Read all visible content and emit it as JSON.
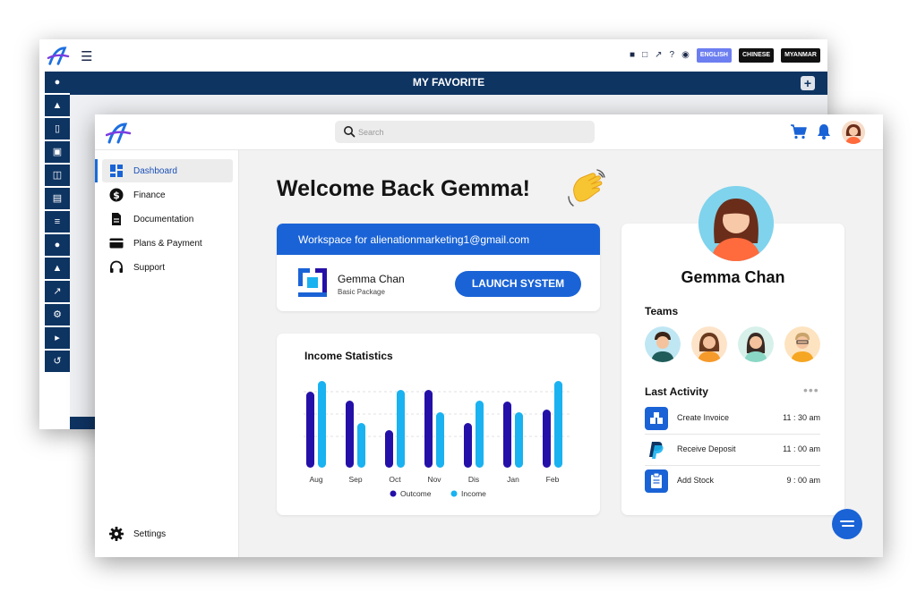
{
  "back_window": {
    "menu_icon": "hamburger-icon",
    "toolbar_icons": [
      "video-icon",
      "monitor-icon",
      "chart-icon",
      "help-icon",
      "account-icon"
    ],
    "languages": [
      {
        "label": "ENGLISH",
        "active": true
      },
      {
        "label": "CHINESE",
        "active": false
      },
      {
        "label": "MYANMAR",
        "active": false
      }
    ],
    "bar_title": "MY FAVORITE",
    "plus_label": "+",
    "side_icons": [
      "user-icon",
      "bank-icon",
      "document-icon",
      "cart-icon",
      "database-icon",
      "money-icon",
      "list-icon",
      "users-icon",
      "institution-icon",
      "chart-icon",
      "gear-icon",
      "login-icon",
      "history-icon"
    ]
  },
  "header": {
    "search_placeholder": "Search"
  },
  "sidebar": {
    "items": [
      {
        "label": "Dashboard",
        "icon": "dashboard-icon",
        "active": true
      },
      {
        "label": "Finance",
        "icon": "dollar-icon",
        "active": false
      },
      {
        "label": "Documentation",
        "icon": "document-icon",
        "active": false
      },
      {
        "label": "Plans & Payment",
        "icon": "card-icon",
        "active": false
      },
      {
        "label": "Support",
        "icon": "headset-icon",
        "active": false
      }
    ],
    "settings_label": "Settings"
  },
  "main": {
    "welcome": "Welcome Back Gemma!",
    "workspace": {
      "header": "Workspace for alienationmarketing1@gmail.com",
      "name": "Gemma Chan",
      "package": "Basic Package",
      "launch_label": "LAUNCH SYSTEM"
    },
    "income_title": "Income Statistics"
  },
  "profile": {
    "name": "Gemma Chan",
    "teams_label": "Teams",
    "last_activity_label": "Last Activity",
    "more_label": "•••",
    "activities": [
      {
        "label": "Create Invoice",
        "time": "11 : 30 am",
        "icon": "invoice-icon"
      },
      {
        "label": "Receive Deposit",
        "time": "11 : 00 am",
        "icon": "paypal-icon"
      },
      {
        "label": "Add Stock",
        "time": "9 : 00 am",
        "icon": "clipboard-icon"
      }
    ]
  },
  "colors": {
    "primary": "#1a63d6",
    "navy": "#0e3462",
    "outcome": "#2410a8",
    "income": "#1ab2f0"
  },
  "chart_data": {
    "type": "bar",
    "title": "Income Statistics",
    "categories": [
      "Aug",
      "Sep",
      "Oct",
      "Nov",
      "Dis",
      "Jan",
      "Feb"
    ],
    "series": [
      {
        "name": "Outcome",
        "values": [
          85,
          75,
          42,
          87,
          50,
          74,
          65
        ]
      },
      {
        "name": "Income",
        "values": [
          97,
          50,
          87,
          62,
          75,
          62,
          97
        ]
      }
    ],
    "ylim": [
      0,
      100
    ],
    "grid": true,
    "legend_position": "bottom"
  }
}
